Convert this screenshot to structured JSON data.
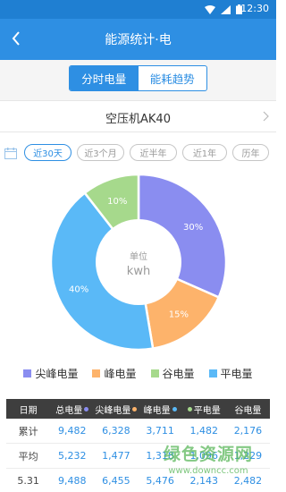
{
  "status_bar": {
    "time": "12:30"
  },
  "header": {
    "title": "能源统计·电"
  },
  "tabs": [
    {
      "label": "分时电量",
      "active": true
    },
    {
      "label": "能耗趋势",
      "active": false
    }
  ],
  "device": {
    "name": "空压机AK40"
  },
  "filters": [
    "近30天",
    "近3个月",
    "近半年",
    "近1年",
    "历年"
  ],
  "chart_data": {
    "type": "pie",
    "center_label": "单位",
    "center_unit": "kwh",
    "slices": [
      {
        "name": "尖峰电量",
        "value": 30,
        "label": "30%",
        "color": "#8a8df0"
      },
      {
        "name": "峰电量",
        "value": 15,
        "label": "15%",
        "color": "#fdb36b"
      },
      {
        "name": "平电量",
        "value": 40,
        "label": "40%",
        "color": "#5ab9f7"
      },
      {
        "name": "谷电量",
        "value": 10,
        "label": "10%",
        "color": "#a6d98c"
      }
    ]
  },
  "legend": [
    {
      "label": "尖峰电量",
      "color": "#8a8df0"
    },
    {
      "label": "峰电量",
      "color": "#fdb36b"
    },
    {
      "label": "谷电量",
      "color": "#a6d98c"
    },
    {
      "label": "平电量",
      "color": "#5ab9f7"
    }
  ],
  "table": {
    "headers": [
      {
        "label": "日期",
        "dot": null
      },
      {
        "label": "总电量",
        "dot": "#8a8df0"
      },
      {
        "label": "尖峰电量",
        "dot": "#fdb36b"
      },
      {
        "label": "峰电量",
        "dot": "#5ab9f7"
      },
      {
        "label": "平电量",
        "dot": "#a6d98c"
      },
      {
        "label": "谷电量",
        "dot": null
      }
    ],
    "rows": [
      [
        "累计",
        "9,482",
        "6,328",
        "3,711",
        "1,482",
        "2,176"
      ],
      [
        "平均",
        "5,232",
        "1,477",
        "1,318",
        "1,096",
        "1,229"
      ],
      [
        "5.31",
        "9,488",
        "6,455",
        "5,476",
        "2,143",
        "2,482"
      ]
    ]
  },
  "watermark": {
    "main": "绿色资源网",
    "url": "www.downcc.com"
  }
}
